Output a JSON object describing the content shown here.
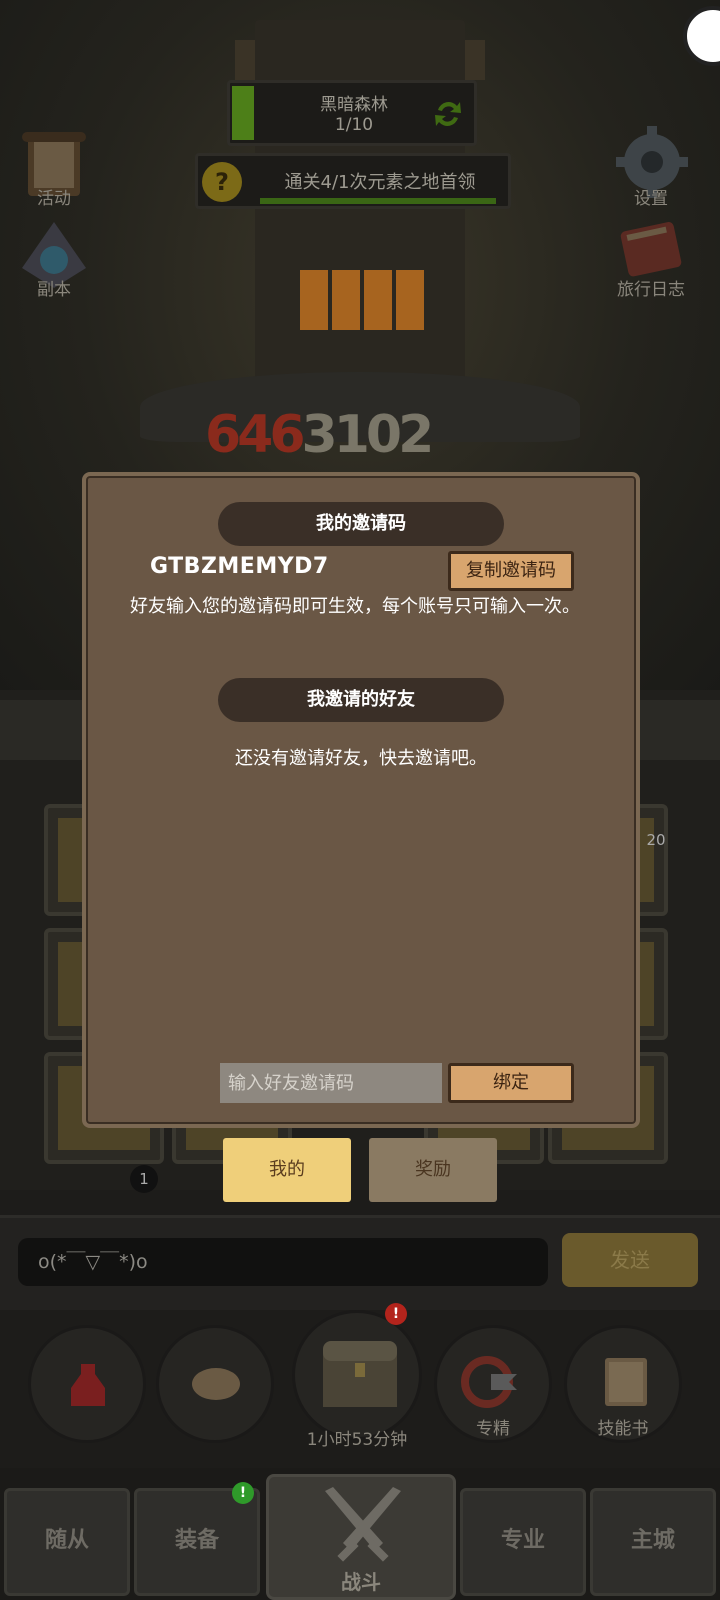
{
  "scene": {
    "stage": {
      "name": "黑暗森林",
      "progress": "1/10"
    },
    "quest": {
      "help_icon": "?",
      "text": "通关4/1次元素之地首领"
    },
    "damage_numbers": {
      "part_a": "646",
      "part_b": "3102"
    },
    "side_left": [
      {
        "label": "活动",
        "icon": "scroll-icon"
      },
      {
        "label": "副本",
        "icon": "portal-icon"
      }
    ],
    "side_right": [
      {
        "label": "设置",
        "icon": "gear-icon"
      },
      {
        "label": "旅行日志",
        "icon": "journal-icon"
      }
    ],
    "card_badges": {
      "top_right": "20",
      "bottom_left": "1"
    }
  },
  "dialog": {
    "my_code_header": "我的邀请码",
    "invite_code": "GTBZMEMYD7",
    "copy_button": "复制邀请码",
    "description": "好友输入您的邀请码即可生效，每个账号只可输入一次。",
    "friends_header": "我邀请的好友",
    "no_friends_text": "还没有邀请好友，快去邀请吧。",
    "code_input_placeholder": "输入好友邀请码",
    "bind_button": "绑定"
  },
  "tabs": [
    {
      "label": "我的",
      "active": true
    },
    {
      "label": "奖励",
      "active": false
    }
  ],
  "chat": {
    "input_value": "o(*￣▽￣*)o",
    "send_button": "发送"
  },
  "actions": [
    {
      "label": "",
      "icon": "potion-icon"
    },
    {
      "label": "",
      "icon": "bread-icon"
    },
    {
      "label": "1小时53分钟",
      "icon": "treasure-chest-icon",
      "alert": "!"
    },
    {
      "label": "专精",
      "icon": "mastery-icon"
    },
    {
      "label": "技能书",
      "icon": "skill-book-icon"
    }
  ],
  "nav": {
    "followers": "随从",
    "equipment": "装备",
    "equipment_badge": "!",
    "battle": "战斗",
    "profession": "专业",
    "main_city": "主城"
  },
  "colors": {
    "dialog_bg": "#6a5745",
    "header_pill": "#3a2f27",
    "wood_button": "#d8a56e",
    "active_tab": "#efcf7a",
    "accent_green": "#4d7f18"
  }
}
